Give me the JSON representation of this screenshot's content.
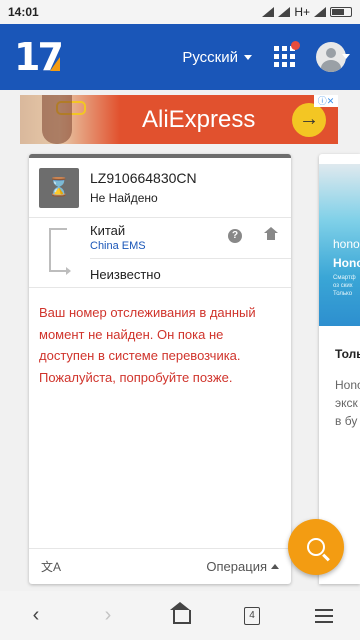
{
  "status_bar": {
    "time": "14:01",
    "network": "H+"
  },
  "header": {
    "logo_text": "17",
    "language": "Русский"
  },
  "ad": {
    "brand": "AliExpress",
    "arrow": "→",
    "badge": "ⓘ✕"
  },
  "tracking": {
    "number": "LZ910664830CN",
    "status": "Не Найдено",
    "origin_country": "Китай",
    "carrier": "China EMS",
    "destination": "Неизвестно",
    "help_glyph": "?",
    "message": "Ваш номер отслеживания в данный момент не найден. Он пока не доступен в системе перевозчика. Пожалуйста, попробуйте позже.",
    "translate_glyph": "文A",
    "operation_label": "Операция"
  },
  "side_card": {
    "promo_line1": "hono",
    "promo_line2": "Hono",
    "promo_line3": "Смартф\nоз ских\nТолько",
    "title": "Толь",
    "body": "Hono\nэкск\nв бу"
  },
  "nav": {
    "back": "‹",
    "forward": "›",
    "tabs_count": "4"
  }
}
